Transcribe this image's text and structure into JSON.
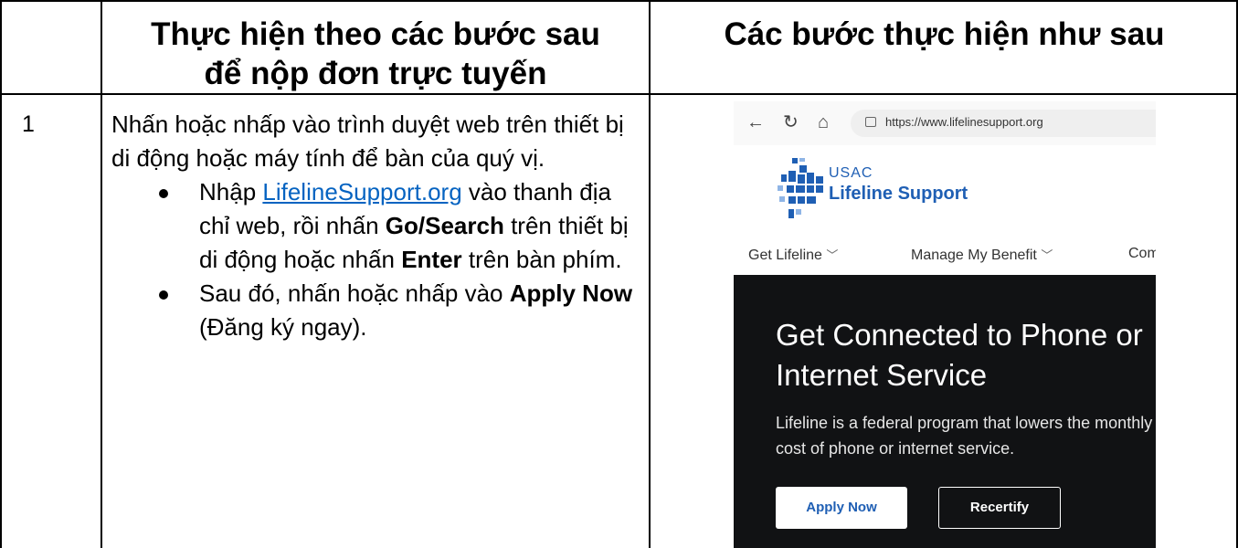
{
  "header": {
    "left_line1": "Thực hiện theo các bước sau",
    "left_line2": "để nộp đơn trực tuyến",
    "right": "Các bước thực hiện như sau"
  },
  "row": {
    "number": "1",
    "intro": "Nhấn hoặc nhấp vào trình duyệt web trên thiết bị di động hoặc máy tính để bàn của quý vị.",
    "bullet1": {
      "pre": "Nhập ",
      "link": "LifelineSupport.org",
      "mid1": " vào thanh địa chỉ web, rồi nhấn ",
      "bold1": "Go/Search",
      "mid2": " trên thiết bị di động hoặc nhấn ",
      "bold2": "Enter",
      "post": " trên bàn phím."
    },
    "bullet2": {
      "pre": "Sau đó, nhấn hoặc nhấp vào ",
      "bold": "Apply Now",
      "post": " (Đăng ký ngay)."
    }
  },
  "screenshot": {
    "url": "https://www.lifelinesupport.org",
    "logo_org": "USAC",
    "logo_name": "Lifeline Support",
    "nav": [
      "Get Lifeline",
      "Manage My Benefit",
      "Com"
    ],
    "hero_title": "Get Connected to Phone or Internet Service",
    "hero_desc": "Lifeline is a federal program that lowers the monthly cost of phone or internet service.",
    "apply_label": "Apply Now",
    "recertify_label": "Recertify",
    "colors": {
      "brand_blue": "#1f5fb4",
      "hero_bg": "#111214"
    }
  }
}
